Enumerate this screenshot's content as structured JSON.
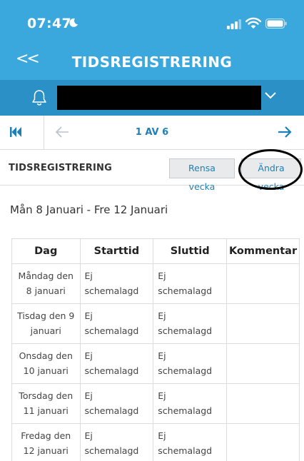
{
  "status_bar": {
    "time": "07:47"
  },
  "header": {
    "back_label": "<<",
    "title": "TIDSREGISTRERING"
  },
  "pager": {
    "indicator": "1 AV 6"
  },
  "section": {
    "title": "TIDSREGISTRERING",
    "clear_week_label": "Rensa vecka",
    "change_week_label": "Ändra vecka"
  },
  "week": {
    "date_range": "Mån 8 Januari - Fre 12 Januari"
  },
  "table": {
    "headers": [
      "Dag",
      "Starttid",
      "Sluttid",
      "Kommentar"
    ],
    "rows": [
      {
        "day": "Måndag den 8 januari",
        "start": "Ej schemalagd",
        "end": "Ej schemalagd",
        "comment": ""
      },
      {
        "day": "Tisdag den 9 januari",
        "start": "Ej schemalagd",
        "end": "Ej schemalagd",
        "comment": ""
      },
      {
        "day": "Onsdag den 10 januari",
        "start": "Ej schemalagd",
        "end": "Ej schemalagd",
        "comment": ""
      },
      {
        "day": "Torsdag den 11 januari",
        "start": "Ej schemalagd",
        "end": "Ej schemalagd",
        "comment": ""
      },
      {
        "day": "Fredag den 12 januari",
        "start": "Ej schemalagd",
        "end": "Ej schemalagd",
        "comment": ""
      }
    ]
  },
  "colors": {
    "header_blue": "#3aa8dd",
    "selector_blue": "#2a90c6",
    "link_blue": "#1f7fb8"
  },
  "icons": [
    "moon-icon",
    "signal-icon",
    "wifi-icon",
    "battery-icon",
    "bell-icon",
    "chevron-down-icon",
    "first-page-icon",
    "arrow-left-icon",
    "arrow-right-icon"
  ]
}
